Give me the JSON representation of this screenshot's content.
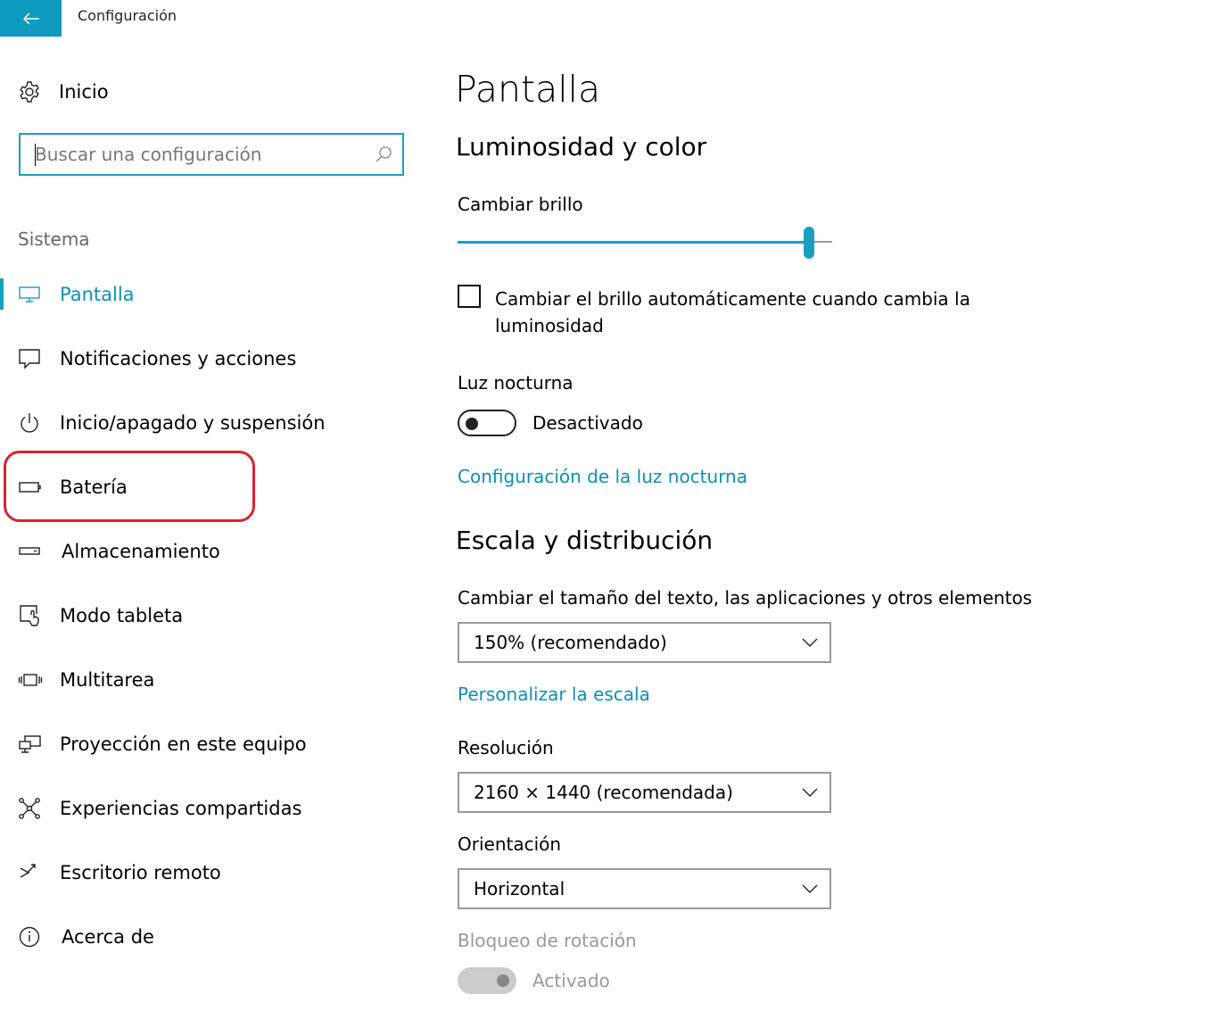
{
  "window": {
    "title": "Configuración"
  },
  "colors": {
    "accent": "#1a9fbe",
    "highlight": "#d9232e",
    "link": "#0f8fb3"
  },
  "sidebar": {
    "home_label": "Inicio",
    "search_placeholder": "Buscar una configuración",
    "group_header": "Sistema",
    "items": [
      {
        "label": "Pantalla",
        "icon": "monitor-icon",
        "active": true
      },
      {
        "label": "Notificaciones y acciones",
        "icon": "notification-icon"
      },
      {
        "label": "Inicio/apagado y suspensión",
        "icon": "power-icon"
      },
      {
        "label": "Batería",
        "icon": "battery-icon"
      },
      {
        "label": "Almacenamiento",
        "icon": "storage-icon"
      },
      {
        "label": "Modo tableta",
        "icon": "tablet-mode-icon"
      },
      {
        "label": "Multitarea",
        "icon": "multitask-icon"
      },
      {
        "label": "Proyección en este equipo",
        "icon": "projection-icon"
      },
      {
        "label": "Experiencias compartidas",
        "icon": "shared-experiences-icon"
      },
      {
        "label": "Escritorio remoto",
        "icon": "remote-desktop-icon"
      },
      {
        "label": "Acerca de",
        "icon": "info-icon"
      }
    ]
  },
  "main": {
    "title": "Pantalla",
    "section_brightness": "Luminosidad y color",
    "brightness_label": "Cambiar brillo",
    "brightness_value": 0.94,
    "auto_brightness_label": "Cambiar el brillo automáticamente cuando cambia la luminosidad",
    "auto_brightness_checked": false,
    "night_light_label": "Luz nocturna",
    "night_light_state": "Desactivado",
    "night_light_link": "Configuración de la luz nocturna",
    "section_scale": "Escala y distribución",
    "scale_label": "Cambiar el tamaño del texto, las aplicaciones y otros elementos",
    "scale_value": "150% (recomendado)",
    "custom_scale_link": "Personalizar la escala",
    "resolution_label": "Resolución",
    "resolution_value": "2160 × 1440 (recomendada)",
    "orientation_label": "Orientación",
    "orientation_value": "Horizontal",
    "rotation_lock_label": "Bloqueo de rotación",
    "rotation_lock_state": "Activado"
  }
}
